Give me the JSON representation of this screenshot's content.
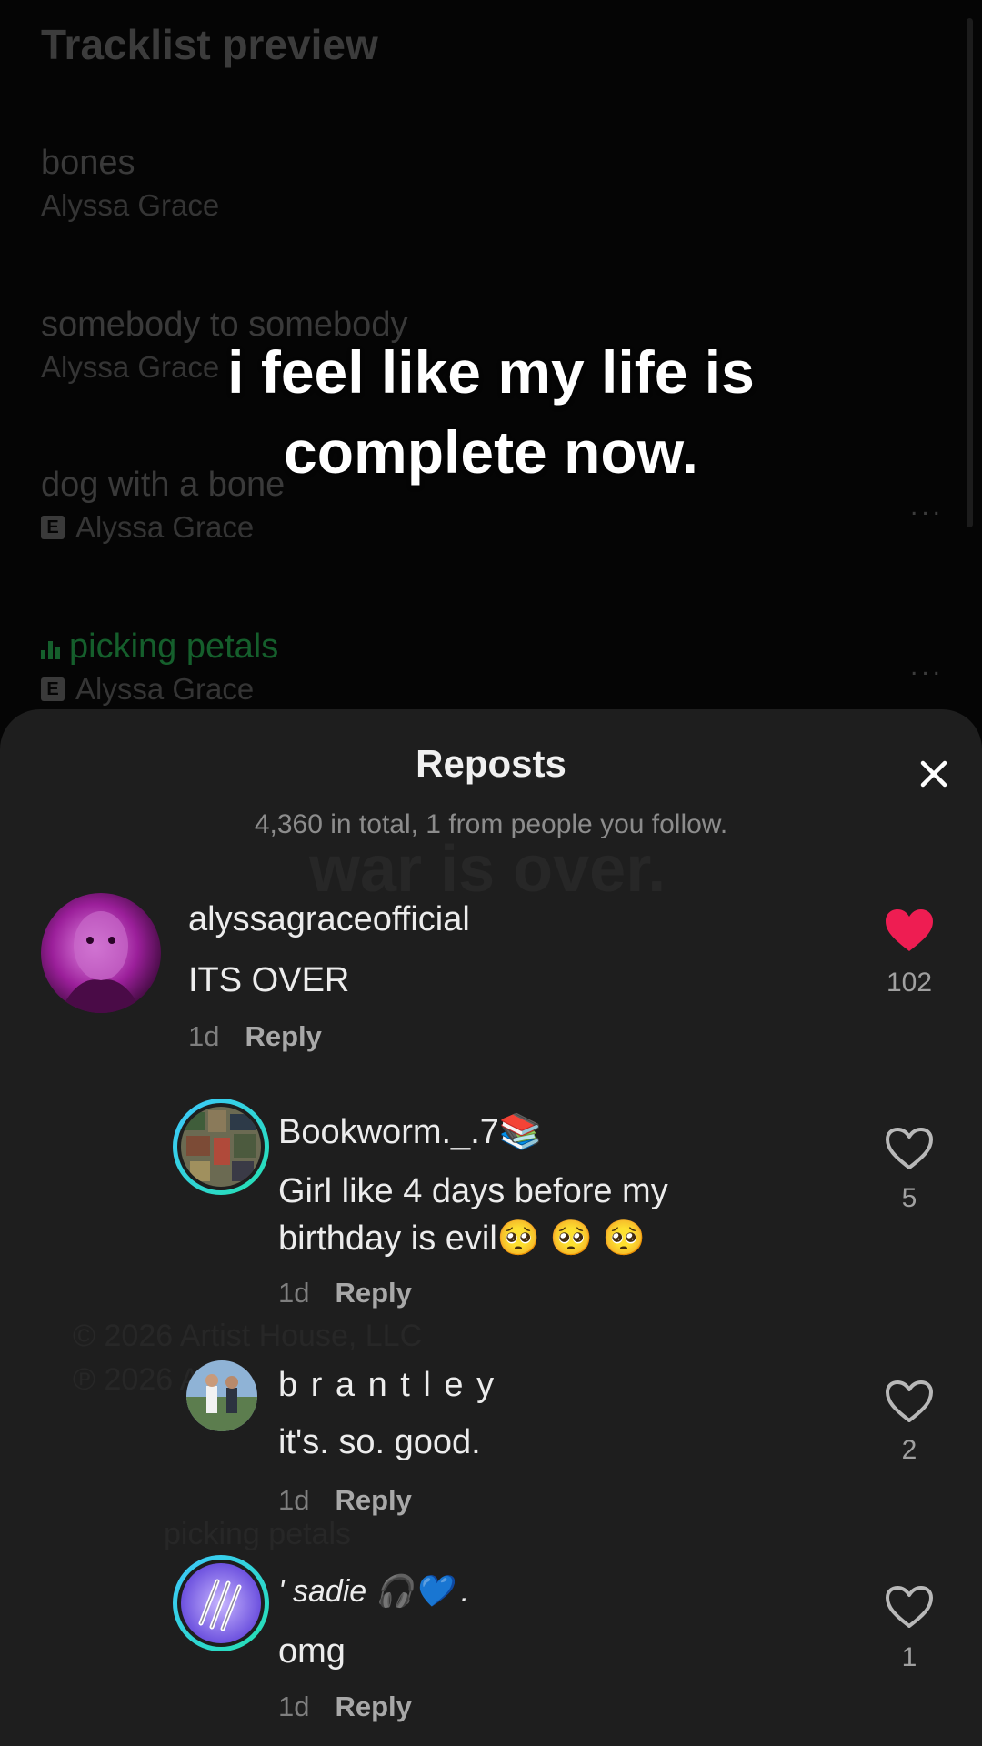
{
  "background": {
    "header": "Tracklist preview",
    "tracks": [
      {
        "name": "bones",
        "artist": "Alyssa Grace",
        "explicit": false
      },
      {
        "name": "somebody to somebody",
        "artist": "Alyssa Grace",
        "explicit": false
      },
      {
        "name": "dog with a bone",
        "artist": "Alyssa Grace",
        "explicit": true,
        "explicit_mark": "E"
      },
      {
        "name": "picking petals",
        "artist": "Alyssa Grace",
        "explicit": true,
        "explicit_mark": "E",
        "playing": true
      }
    ],
    "more_dots": "...",
    "ghost_texts": {
      "war_is_over": "war is over.",
      "copyright_1": "© 2026 Artist House, LLC",
      "copyright_2": "℗ 2026 A",
      "now_playing": "picking petals"
    }
  },
  "overlay_caption": {
    "line1": "i feel like my life is",
    "line2": "complete now."
  },
  "sheet": {
    "title": "Reposts",
    "subtitle": "4,360 in total, 1 from people you follow.",
    "close_icon": "close-icon",
    "colors": {
      "background": "#1e1e1e",
      "liked": "#ee1d52",
      "muted_text": "#8c8c8c"
    }
  },
  "comments": [
    {
      "username": "alyssagraceofficial",
      "text": "ITS OVER",
      "time": "1d",
      "reply_label": "Reply",
      "likes": "102",
      "liked": true
    },
    {
      "username": "Bookworm._.7📚",
      "text": "Girl like 4 days before my birthday is evil🥺 🥺 🥺",
      "time": "1d",
      "reply_label": "Reply",
      "likes": "5",
      "liked": false,
      "story_ring": true
    },
    {
      "username": "b r a n t l e y",
      "text": "it's. so. good.",
      "time": "1d",
      "reply_label": "Reply",
      "likes": "2",
      "liked": false
    },
    {
      "username": "' sadie 🎧💙 .",
      "text": "omg",
      "time": "1d",
      "reply_label": "Reply",
      "likes": "1",
      "liked": false,
      "story_ring": true
    }
  ]
}
